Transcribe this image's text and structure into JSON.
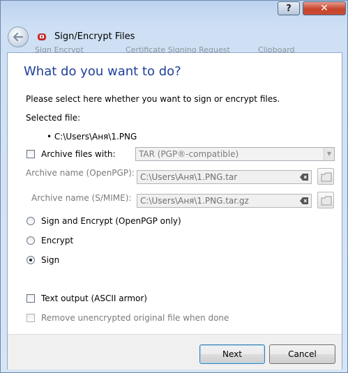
{
  "window": {
    "help_glyph": "?",
    "close_glyph": "✕"
  },
  "navbar": {
    "back_icon": "back-arrow-icon",
    "title": "Sign/Encrypt Files",
    "ghost_items": [
      "Sign Encrypt",
      "Certificate Signing Request",
      "Clipboard"
    ]
  },
  "page": {
    "heading": "What do you want to do?",
    "instruction": "Please select here whether you want to sign or encrypt files.",
    "selected_file_label": "Selected file:",
    "selected_file": "• C:\\Users\\Аня\\1.PNG"
  },
  "archive": {
    "checkbox_label": "Archive files with:",
    "checked": false,
    "format_value": "TAR (PGP®-compatible)",
    "openpgp_label": "Archive name (OpenPGP):",
    "openpgp_value": "C:\\Users\\Аня\\1.PNG.tar",
    "smime_label": "Archive name (S/MIME):",
    "smime_value": "C:\\Users\\Аня\\1.PNG.tar.gz"
  },
  "mode": {
    "options": [
      {
        "label": "Sign and Encrypt (OpenPGP only)",
        "selected": false
      },
      {
        "label": "Encrypt",
        "selected": false
      },
      {
        "label": "Sign",
        "selected": true
      }
    ]
  },
  "options": {
    "text_output_label": "Text output (ASCII armor)",
    "text_output_checked": false,
    "remove_label": "Remove unencrypted original file when done",
    "remove_checked": false
  },
  "buttons": {
    "next": "Next",
    "cancel": "Cancel"
  }
}
